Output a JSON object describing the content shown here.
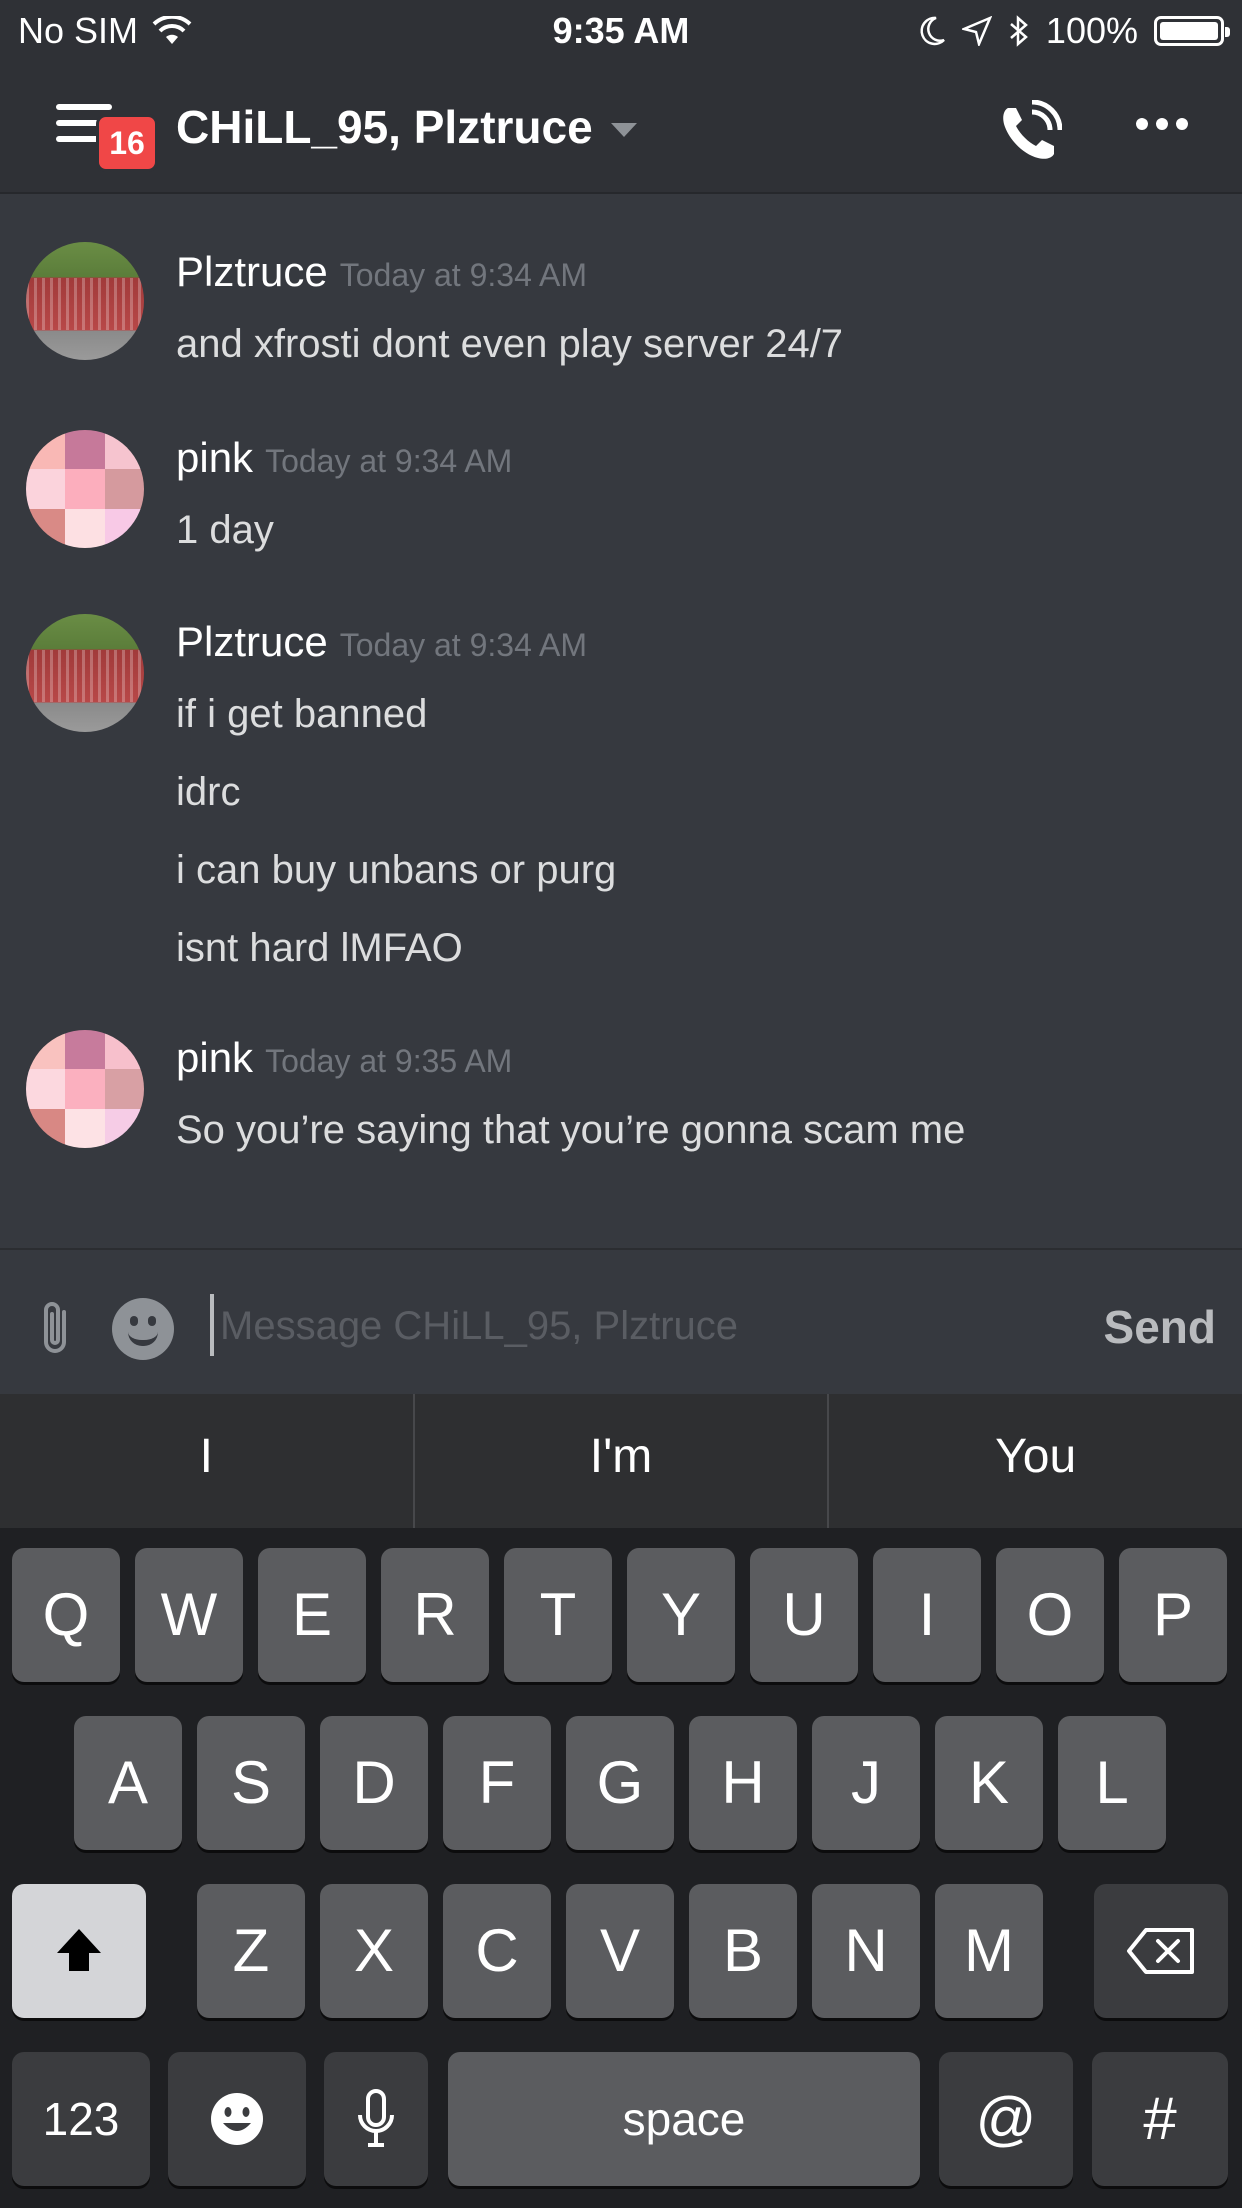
{
  "status_bar": {
    "carrier": "No SIM",
    "time": "9:35 AM",
    "battery": "100%"
  },
  "header": {
    "unread_badge": "16",
    "title": "CHiLL_95, Plztruce"
  },
  "messages": [
    {
      "author": "Plztruce",
      "timestamp": "Today at 9:34 AM",
      "avatar": "building-avatar",
      "lines": [
        "and xfrosti dont even play server 24/7"
      ]
    },
    {
      "author": "pink",
      "timestamp": "Today at 9:34 AM",
      "avatar": "pink-pixel-avatar",
      "lines": [
        "1 day"
      ]
    },
    {
      "author": "Plztruce",
      "timestamp": "Today at 9:34 AM",
      "avatar": "building-avatar",
      "lines": [
        "if i get banned",
        "idrc",
        "i can buy unbans or purg",
        "isnt hard lMFAO"
      ]
    },
    {
      "author": "pink",
      "timestamp": "Today at 9:35 AM",
      "avatar": "pink-pixel-avatar",
      "lines": [
        "So you’re saying that you’re gonna scam me"
      ]
    }
  ],
  "composer": {
    "placeholder": "Message CHiLL_95, Plztruce",
    "send_label": "Send"
  },
  "keyboard": {
    "suggestions": [
      "I",
      "I'm",
      "You"
    ],
    "row1": [
      "Q",
      "W",
      "E",
      "R",
      "T",
      "Y",
      "U",
      "I",
      "O",
      "P"
    ],
    "row2": [
      "A",
      "S",
      "D",
      "F",
      "G",
      "H",
      "J",
      "K",
      "L"
    ],
    "row3": [
      "Z",
      "X",
      "C",
      "V",
      "B",
      "N",
      "M"
    ],
    "numbers_label": "123",
    "space_label": "space",
    "at_label": "@",
    "hash_label": "#"
  },
  "colors": {
    "background": "#36393f",
    "header": "#2f3136",
    "badge": "#f04747",
    "timestamp": "#72767d"
  }
}
